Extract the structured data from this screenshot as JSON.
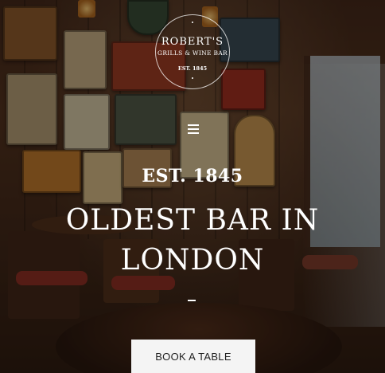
{
  "logo": {
    "name": "ROBERT'S",
    "subtitle": "GRILLS & WINE BAR",
    "est": "EST. 1845"
  },
  "menu": {
    "icon": "hamburger-menu-icon"
  },
  "hero": {
    "eyebrow": "EST. 1845",
    "headline_line1": "OLDEST BAR IN",
    "headline_line2": "LONDON"
  },
  "cta": {
    "book_label": "BOOK A TABLE"
  },
  "background": {
    "description_icon": "pub-interior-photo"
  }
}
